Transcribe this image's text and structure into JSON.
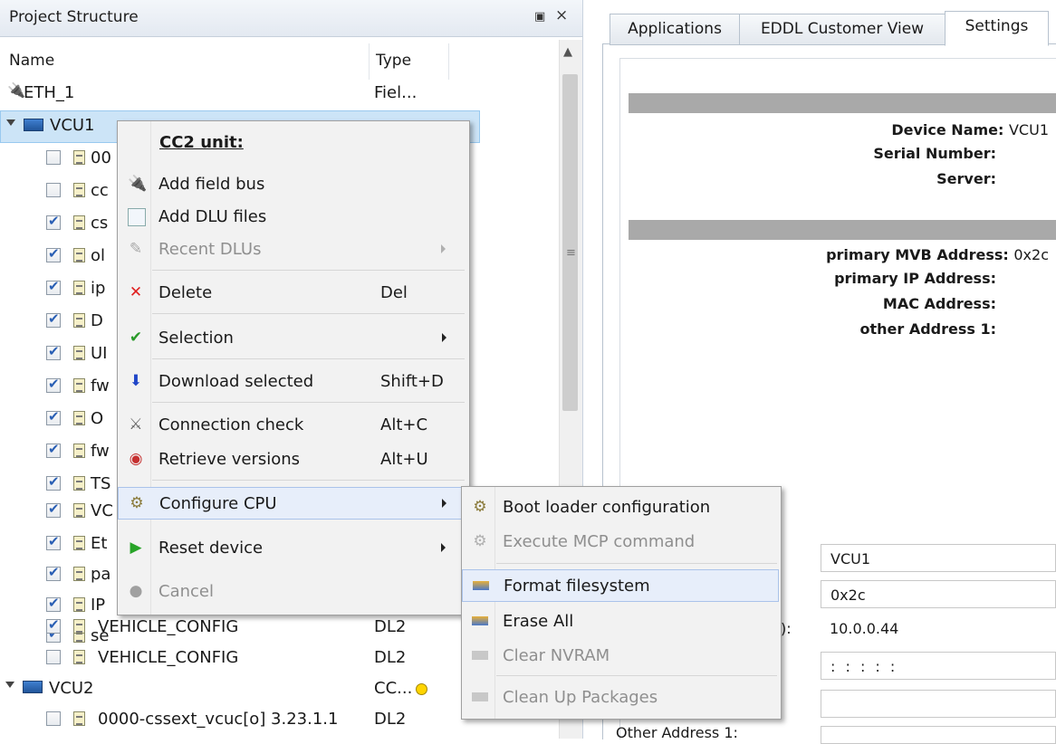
{
  "left_panel": {
    "title": "Project Structure",
    "float_icon": "▣",
    "close_icon": "×",
    "columns": {
      "name": "Name",
      "type": "Type"
    },
    "rows": [
      {
        "name": "ETH_1",
        "type": "Fiel..."
      },
      {
        "name": "VCU1",
        "type": ""
      },
      {
        "name": "00",
        "type": ""
      },
      {
        "name": "cc",
        "type": ""
      },
      {
        "name": "cs",
        "type": ""
      },
      {
        "name": "ol",
        "type": ""
      },
      {
        "name": "ip",
        "type": ""
      },
      {
        "name": "D",
        "type": ""
      },
      {
        "name": "UI",
        "type": ""
      },
      {
        "name": "fw",
        "type": ""
      },
      {
        "name": "O",
        "type": ""
      },
      {
        "name": "fw",
        "type": ""
      },
      {
        "name": "TS",
        "type": ""
      },
      {
        "name": "VC",
        "type": ""
      },
      {
        "name": "Et",
        "type": ""
      },
      {
        "name": "pa",
        "type": ""
      },
      {
        "name": "IP",
        "type": ""
      },
      {
        "name": "se",
        "type": ""
      },
      {
        "name": "VEHICLE_CONFIG",
        "type": "DL2"
      },
      {
        "name": "VEHICLE_CONFIG",
        "type": "DL2"
      },
      {
        "name": "VCU2",
        "type": "CC..."
      },
      {
        "name": "0000-cssext_vcuc[o] 3.23.1.1",
        "type": "DL2"
      }
    ]
  },
  "right_panel": {
    "tabs": [
      "Applications",
      "EDDL Customer View",
      "Settings"
    ],
    "device_name_label": "Device Name:",
    "device_name_value": "VCU1",
    "serial_number_label": "Serial Number:",
    "server_label": "Server:",
    "mvb_label": "primary MVB Address:",
    "mvb_value": "0x2c",
    "ip_label": "primary IP Address:",
    "mac_label": "MAC Address:",
    "other_label": "other Address 1:",
    "fields": {
      "device_name": "VCU1",
      "mvb": "0x2c",
      "ip_suffix_label": "ne):",
      "ip": "10.0.0.44",
      "mac": ": : : : :",
      "other_label_partial": "Other Address 1:"
    }
  },
  "context_menu": {
    "header": "CC2 unit:",
    "items": [
      {
        "label": "Add field bus",
        "shortcut": "",
        "icon": "fieldbus-icon"
      },
      {
        "label": "Add DLU files",
        "shortcut": "",
        "icon": "dlu-file-icon"
      },
      {
        "label": "Recent DLUs",
        "shortcut": "",
        "icon": "recent-icon"
      },
      {
        "label": "Delete",
        "shortcut": "Del",
        "icon": "delete-icon"
      },
      {
        "label": "Selection",
        "shortcut": "",
        "icon": "checkmark-icon"
      },
      {
        "label": "Download selected",
        "shortcut": "Shift+D",
        "icon": "download-icon"
      },
      {
        "label": "Connection check",
        "shortcut": "Alt+C",
        "icon": "connection-icon"
      },
      {
        "label": "Retrieve versions",
        "shortcut": "Alt+U",
        "icon": "retrieve-icon"
      },
      {
        "label": "Configure CPU",
        "shortcut": "",
        "icon": "gear-icon"
      },
      {
        "label": "Reset device",
        "shortcut": "",
        "icon": "play-icon"
      },
      {
        "label": "Cancel",
        "shortcut": "",
        "icon": "cancel-icon"
      }
    ]
  },
  "submenu": {
    "items": [
      {
        "label": "Boot loader configuration",
        "icon": "gear-icon"
      },
      {
        "label": "Execute MCP command",
        "icon": "gear-icon"
      },
      {
        "label": "Format filesystem",
        "icon": "disk-icon"
      },
      {
        "label": "Erase All",
        "icon": "disk-icon"
      },
      {
        "label": "Clear NVRAM",
        "icon": "disk-icon"
      },
      {
        "label": "Clean Up Packages",
        "icon": "disk-icon"
      }
    ]
  },
  "colors": {
    "selection": "#cce4f7",
    "menu_highlight": "#e7eefa",
    "header_bar": "#a9a9a9"
  }
}
